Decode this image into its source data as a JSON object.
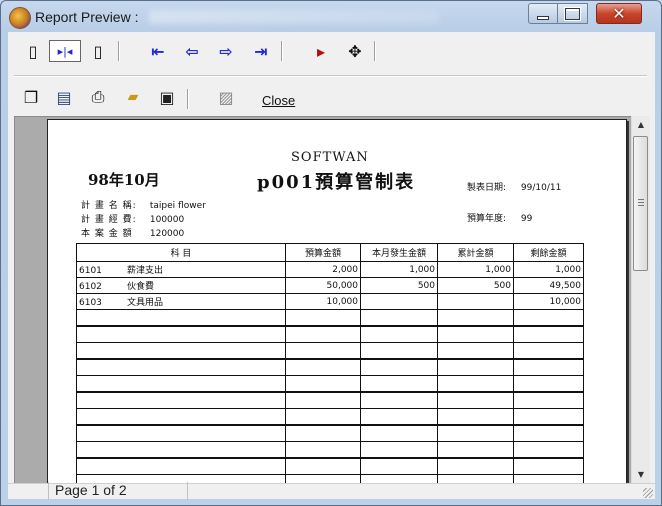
{
  "window": {
    "title": "Report Preview :",
    "min_label": "",
    "max_label": "",
    "close_label": "✕"
  },
  "toolbar1": {
    "buttons": [
      {
        "name": "single-page-icon",
        "glyph": "▯"
      },
      {
        "name": "two-page-icon",
        "glyph": "▫▫"
      },
      {
        "name": "page-width-icon",
        "glyph": "▯"
      },
      {
        "name": "first-page-icon",
        "glyph": "⇤"
      },
      {
        "name": "prev-page-icon",
        "glyph": "⇦"
      },
      {
        "name": "next-page-icon",
        "glyph": "⇨"
      },
      {
        "name": "last-page-icon",
        "glyph": "⇥"
      },
      {
        "name": "goto-page-icon",
        "glyph": "▸"
      },
      {
        "name": "find-icon",
        "glyph": "✥"
      }
    ]
  },
  "toolbar2": {
    "buttons": [
      {
        "name": "copy-icon",
        "glyph": "❐"
      },
      {
        "name": "print-setup-icon",
        "glyph": "▤"
      },
      {
        "name": "print-icon",
        "glyph": "⎙"
      },
      {
        "name": "open-icon",
        "glyph": "📂"
      },
      {
        "name": "save-icon",
        "glyph": "💾"
      },
      {
        "name": "export-icon",
        "glyph": "▨"
      }
    ],
    "close_label": "Close"
  },
  "report": {
    "company": "SOFTWAN",
    "title": "p001預算管制表",
    "period": "98年10月",
    "print_date_label": "製表日期:",
    "print_date": "99/10/11",
    "budget_year_label": "預算年度:",
    "budget_year": "99",
    "plan_name_label": "計 畫 名 稱:",
    "plan_name": "taipei flower",
    "plan_budget_label": "計 畫 經 費:",
    "plan_budget": "100000",
    "actual_amount_label": "本 案 金 額",
    "actual_amount": "120000",
    "columns": [
      "科 目",
      "預算金額",
      "本月發生金額",
      "累計金額",
      "剩餘金額"
    ],
    "rows": [
      {
        "code": "6101",
        "name": "薪津支出",
        "budget": "2,000",
        "month": "1,000",
        "cumulative": "1,000",
        "remaining": "1,000"
      },
      {
        "code": "6102",
        "name": "伙食費",
        "budget": "50,000",
        "month": "500",
        "cumulative": "500",
        "remaining": "49,500"
      },
      {
        "code": "6103",
        "name": "文具用品",
        "budget": "10,000",
        "month": "",
        "cumulative": "",
        "remaining": "10,000"
      }
    ]
  },
  "status": {
    "page_text": "Page 1 of 2"
  }
}
